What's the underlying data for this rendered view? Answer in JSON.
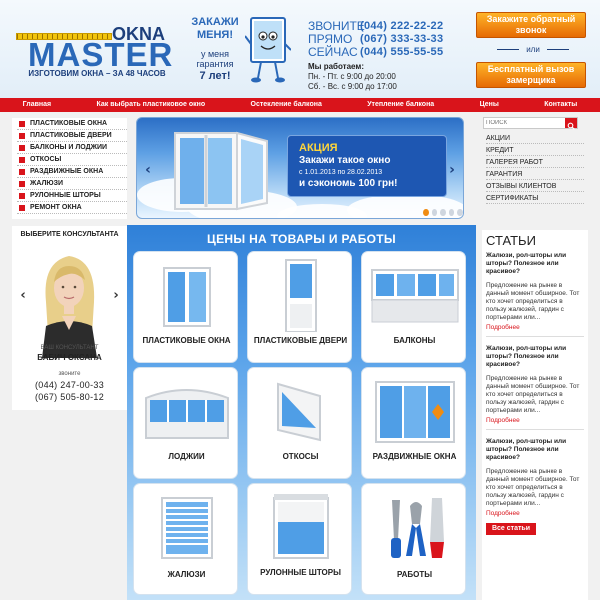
{
  "colors": {
    "accent_red": "#d9141b",
    "brand_blue": "#2a68b8",
    "orange": "#f08c12",
    "panel_blue": "#2f80d8"
  },
  "header": {
    "logo": {
      "okna": "OKNA",
      "master": "MASTER",
      "tagline": "ИЗГОТОВИМ ОКНА – ЗА 48 ЧАСОВ"
    },
    "mascot": {
      "line1": "ЗАКАЖИ МЕНЯ!",
      "line2": "у меня гарантия",
      "line3": "7 лет!"
    },
    "contacts": {
      "lines": [
        {
          "label": "ЗВОНИТЕ",
          "phone": "(044) 222-22-22"
        },
        {
          "label": "ПРЯМО",
          "phone": "(067) 333-33-33"
        },
        {
          "label": "СЕЙЧАС",
          "phone": "(044) 555-55-55"
        }
      ],
      "work_title": "Мы работаем:",
      "hours": [
        "Пн. - Пт. с 9:00 до 20:00",
        "Сб. - Вс. с 9:00 до 17:00"
      ]
    },
    "callback_button": "Закажите обратный звонок",
    "or_label": "или",
    "measure_button": "Бесплатный вызов замерщика"
  },
  "nav": [
    "Главная",
    "Как выбрать пластиковое окно",
    "Остекление балкона",
    "Утепление балкона",
    "Цены",
    "Контакты"
  ],
  "left_menu": [
    "ПЛАСТИКОВЫЕ ОКНА",
    "ПЛАСТИКОВЫЕ ДВЕРИ",
    "БАЛКОНЫ И ЛОДЖИИ",
    "ОТКОСЫ",
    "РАЗДВИЖНЫЕ ОКНА",
    "ЖАЛЮЗИ",
    "РУЛОННЫЕ ШТОРЫ",
    "РЕМОНТ ОКНА"
  ],
  "banner": {
    "title": "АКЦИЯ",
    "line1": "Закажи такое окно",
    "line2": "с 1.01.2013 по 28.02.2013",
    "line3": "и сэкономь 100 грн!",
    "prev_icon": "chevron-left-icon",
    "next_icon": "chevron-right-icon",
    "slide_count": 5,
    "active_slide": 1
  },
  "search": {
    "placeholder": "ПОИСК",
    "icon": "search-icon"
  },
  "right_links": [
    "АКЦИИ",
    "КРЕДИТ",
    "ГАЛЕРЕЯ РАБОТ",
    "ГАРАНТИЯ",
    "ОТЗЫВЫ КЛИЕНТОВ",
    "СЕРТИФИКАТЫ"
  ],
  "consultant": {
    "title": "ВЫБЕРИТЕ КОНСУЛЬТАНТА",
    "role": "ВАШ КОНСУЛЬТАНТ",
    "name": "БАБИЧ ОКСАНА",
    "call_label": "звоните",
    "phones": [
      "(044) 247-00-33",
      "(067) 505-80-12"
    ]
  },
  "prices": {
    "title": "ЦЕНЫ НА ТОВАРЫ И РАБОТЫ",
    "tiles": [
      "ПЛАСТИКОВЫЕ ОКНА",
      "ПЛАСТИКОВЫЕ ДВЕРИ",
      "БАЛКОНЫ",
      "ЛОДЖИИ",
      "ОТКОСЫ",
      "РАЗДВИЖНЫЕ ОКНА",
      "ЖАЛЮЗИ",
      "РУЛОННЫЕ ШТОРЫ",
      "РАБОТЫ"
    ]
  },
  "articles": {
    "title": "СТАТЬИ",
    "items": [
      {
        "title": "Жалюзи, рол-шторы или шторы? Полезное или красивое?",
        "text": "Предложение на рынке в данный момент обширное. Тот кто хочет определиться в пользу жалюзей, гардин с портьерами или...",
        "more": "Подробнее"
      },
      {
        "title": "Жалюзи, рол-шторы или шторы? Полезное или красивое?",
        "text": "Предложение на рынке в данный момент обширное. Тот кто хочет определиться в пользу жалюзей, гардин с портьерами или...",
        "more": "Подробнее"
      },
      {
        "title": "Жалюзи, рол-шторы или шторы? Полезное или красивое?",
        "text": "Предложение на рынке в данный момент обширное. Тот кто хочет определиться в пользу жалюзей, гардин с портьерами или...",
        "more": "Подробнее"
      }
    ],
    "all_button": "Все статьи"
  }
}
